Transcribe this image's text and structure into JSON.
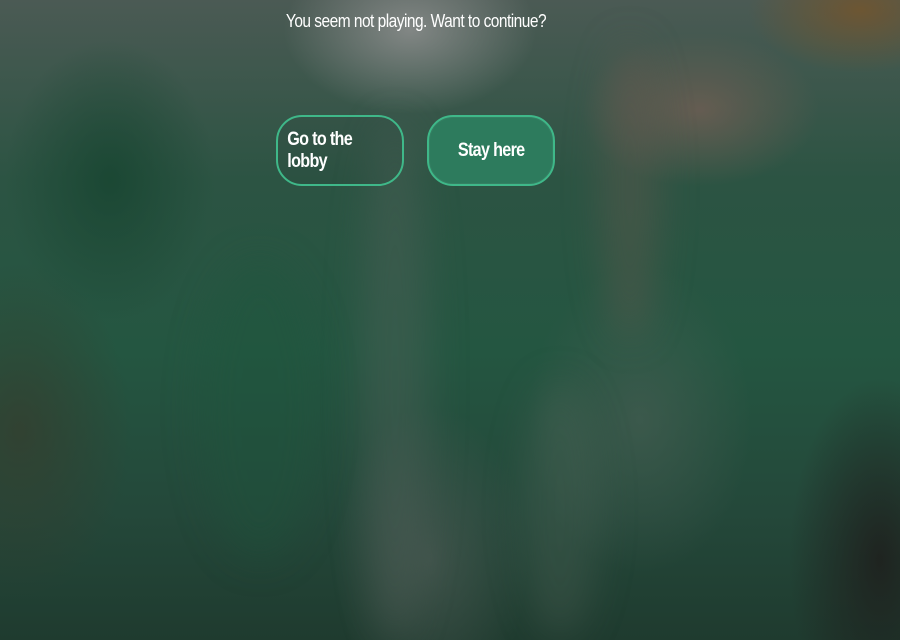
{
  "dialog": {
    "message": "You seem not playing. Want to continue?",
    "lobby_button_label": "Go to the lobby",
    "stay_button_label": "Stay here"
  },
  "colors": {
    "accent_border": "#3fb889",
    "stay_button_fill": "#2d7b5d",
    "text": "#ffffff"
  }
}
